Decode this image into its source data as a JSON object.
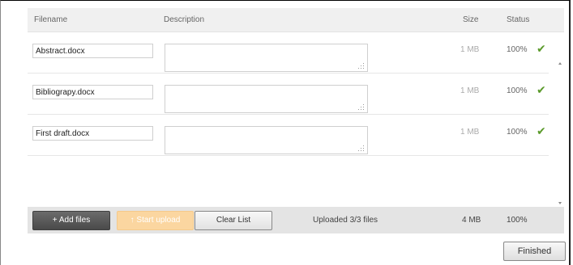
{
  "header": {
    "filename": "Filename",
    "description": "Description",
    "size": "Size",
    "status": "Status"
  },
  "files": [
    {
      "name": "Abstract.docx",
      "description": "",
      "size": "1 MB",
      "percent": "100%",
      "status_icon": "check-icon"
    },
    {
      "name": "Bibliograpy.docx",
      "description": "",
      "size": "1 MB",
      "percent": "100%",
      "status_icon": "check-icon"
    },
    {
      "name": "First draft.docx",
      "description": "",
      "size": "1 MB",
      "percent": "100%",
      "status_icon": "check-icon"
    }
  ],
  "footer": {
    "add_files": "+ Add files",
    "start_upload": "↑ Start upload",
    "clear_list": "Clear List",
    "status": "Uploaded 3/3 files",
    "total_size": "4 MB",
    "total_percent": "100%"
  },
  "finished_button": "Finished",
  "colors": {
    "check": "#5a9a2a",
    "start_upload_disabled": "#fbd6a0",
    "add_files_bg": "#5a5a5a"
  }
}
